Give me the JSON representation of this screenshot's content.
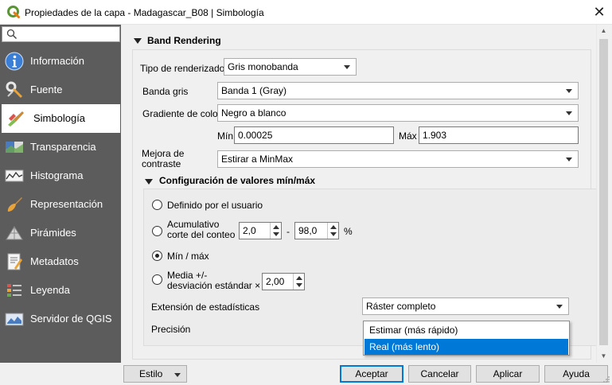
{
  "window": {
    "title": "Propiedades de la capa - Madagascar_B08 | Simbología",
    "close_icon": "close-icon",
    "app_icon": "qgis-logo-icon"
  },
  "sidebar": {
    "search_placeholder": "",
    "items": [
      {
        "label": "Información",
        "icon": "info-icon"
      },
      {
        "label": "Fuente",
        "icon": "source-settings-icon"
      },
      {
        "label": "Simbología",
        "icon": "symbology-brush-icon",
        "active": true
      },
      {
        "label": "Transparencia",
        "icon": "transparency-icon"
      },
      {
        "label": "Histograma",
        "icon": "histogram-icon"
      },
      {
        "label": "Representación",
        "icon": "rendering-brush-icon"
      },
      {
        "label": "Pirámides",
        "icon": "pyramids-icon"
      },
      {
        "label": "Metadatos",
        "icon": "metadata-icon"
      },
      {
        "label": "Leyenda",
        "icon": "legend-icon"
      },
      {
        "label": "Servidor de QGIS",
        "icon": "server-icon"
      }
    ]
  },
  "band_rendering": {
    "title": "Band Rendering",
    "renderer_label": "Tipo de renderizador",
    "renderer_value": "Gris monobanda",
    "gray_band_label": "Banda gris",
    "gray_band_value": "Banda 1 (Gray)",
    "gradient_label": "Gradiente de color",
    "gradient_value": "Negro a blanco",
    "min_label": "Mín",
    "min_value": "0.00025",
    "max_label": "Máx",
    "max_value": "1.903",
    "contrast_label_line1": "Mejora de",
    "contrast_label_line2": "contraste",
    "contrast_value": "Estirar a MinMax"
  },
  "minmax": {
    "title": "Configuración de valores mín/máx",
    "opt_user": "Definido por el usuario",
    "opt_cumulative_line1": "Acumulativo",
    "opt_cumulative_line2": "corte del conteo",
    "cumulative_low": "2,0",
    "cumulative_sep": "-",
    "cumulative_high": "98,0",
    "percent": "%",
    "opt_minmax": "Mín / máx",
    "opt_stddev_line1": "Media +/-",
    "opt_stddev_line2": "desviación estándar ×",
    "stddev_value": "2,00",
    "stats_extent_label": "Extensión de estadísticas",
    "stats_extent_value": "Ráster completo",
    "precision_label": "Precisión",
    "precision_options": [
      "Estimar (más rápido)",
      "Real (más lento)"
    ],
    "precision_selected": "Real (más lento)"
  },
  "footer": {
    "style": "Estilo",
    "accept": "Aceptar",
    "cancel": "Cancelar",
    "apply": "Aplicar",
    "help": "Ayuda"
  },
  "colors": {
    "sidebar_bg": "#5c5c5c",
    "accent": "#0078d7",
    "qgis_green": "#589632"
  }
}
